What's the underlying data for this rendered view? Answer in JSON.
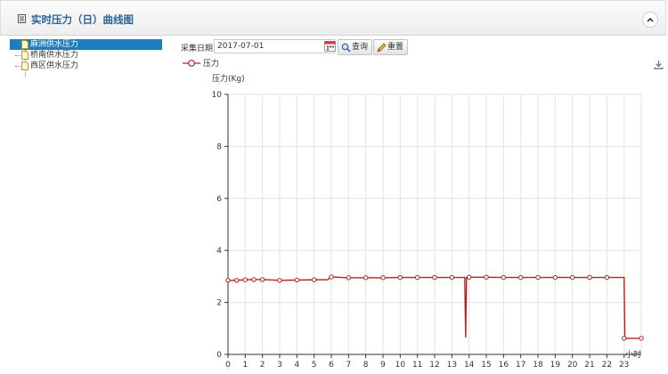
{
  "header": {
    "title": "实时压力（日）曲线图"
  },
  "tree": {
    "items": [
      {
        "label": "麻洲供水压力",
        "selected": true
      },
      {
        "label": "桥南供水压力",
        "selected": false
      },
      {
        "label": "西区供水压力",
        "selected": false
      }
    ]
  },
  "filter": {
    "date_label": "采集日期",
    "date_value": "2017-07-01",
    "query_button": "查询",
    "reset_button": "重置"
  },
  "colors": {
    "series": "#b52121",
    "accent": "#1a7ec1",
    "title": "#2a6496"
  },
  "icons": [
    "list-icon",
    "chevron-up-icon",
    "document-icon",
    "calendar-icon",
    "magnifier-icon",
    "pencil-icon",
    "download-icon"
  ],
  "chart_data": {
    "type": "line",
    "ylabel": "压力(Kg)",
    "xlabel": "小时",
    "legend": "top-left",
    "grid": true,
    "ylim": [
      0,
      10
    ],
    "xlim": [
      0,
      24
    ],
    "yticks": [
      0,
      2,
      4,
      6,
      8,
      10
    ],
    "xticks": [
      0,
      1,
      2,
      3,
      4,
      5,
      6,
      7,
      8,
      9,
      10,
      11,
      12,
      13,
      14,
      15,
      16,
      17,
      18,
      19,
      20,
      21,
      22,
      23
    ],
    "series": [
      {
        "name": "压力",
        "marker_x": [
          0,
          0.5,
          1,
          1.5,
          2,
          3,
          4,
          5,
          6,
          7,
          8,
          9,
          10,
          11,
          12,
          13,
          14,
          15,
          16,
          17,
          18,
          19,
          20,
          21,
          22,
          23,
          24
        ],
        "marker_y": [
          2.85,
          2.85,
          2.87,
          2.88,
          2.88,
          2.85,
          2.86,
          2.87,
          2.98,
          2.95,
          2.95,
          2.95,
          2.96,
          2.96,
          2.96,
          2.96,
          2.97,
          2.97,
          2.96,
          2.96,
          2.96,
          2.96,
          2.96,
          2.96,
          2.96,
          0.62,
          0.62
        ],
        "x": [
          0,
          0.5,
          1,
          1.5,
          2,
          3,
          4,
          5,
          5.8,
          5.95,
          6,
          7,
          8,
          9,
          10,
          11,
          12,
          13,
          13.75,
          13.8,
          13.85,
          14,
          15,
          16,
          17,
          18,
          19,
          20,
          21,
          22,
          23,
          23.05,
          24
        ],
        "y": [
          2.85,
          2.85,
          2.87,
          2.88,
          2.88,
          2.85,
          2.86,
          2.87,
          2.87,
          2.98,
          2.98,
          2.95,
          2.95,
          2.95,
          2.96,
          2.96,
          2.96,
          2.96,
          2.96,
          0.65,
          2.96,
          2.97,
          2.97,
          2.96,
          2.96,
          2.96,
          2.96,
          2.96,
          2.96,
          2.96,
          2.96,
          0.62,
          0.62
        ]
      }
    ]
  }
}
